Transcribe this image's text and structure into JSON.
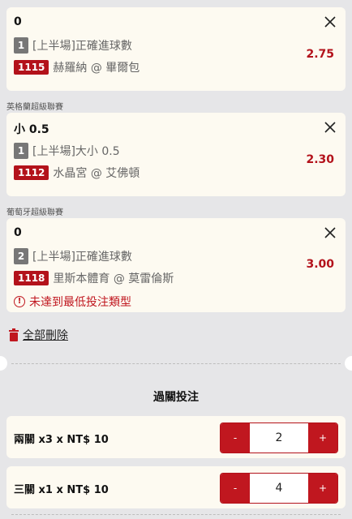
{
  "bets": [
    {
      "selection": "0",
      "half_number": "1",
      "market": "[上半場]正確進球數",
      "match_number": "1115",
      "match": "赫羅納 @ 畢爾包",
      "odds": "2.75"
    },
    {
      "league": "英格蘭超級聯賽",
      "selection": "小 0.5",
      "half_number": "1",
      "market": "[上半場]大小 0.5",
      "match_number": "1112",
      "match": "水晶宮 @ 艾佛頓",
      "odds": "2.30"
    },
    {
      "league": "葡萄牙超級聯賽",
      "selection": "0",
      "half_number": "2",
      "market": "[上半場]正確進球數",
      "match_number": "1118",
      "match": "里斯本體育 @ 莫雷倫斯",
      "odds": "3.00",
      "warning": "未達到最低投注類型"
    }
  ],
  "delete_all_label": "全部刪除",
  "parlay": {
    "title": "過關投注",
    "rows": [
      {
        "label": "兩關",
        "detail": "x3 x NT$ 10",
        "value": "2",
        "minus": "-",
        "plus": "+"
      },
      {
        "label": "三關",
        "detail": "x1 x NT$ 10",
        "value": "4",
        "minus": "-",
        "plus": "+"
      }
    ]
  },
  "colors": {
    "accent": "#b3121b",
    "card_bg": "#fdfaf1",
    "page_bg": "#e6e6e8"
  }
}
